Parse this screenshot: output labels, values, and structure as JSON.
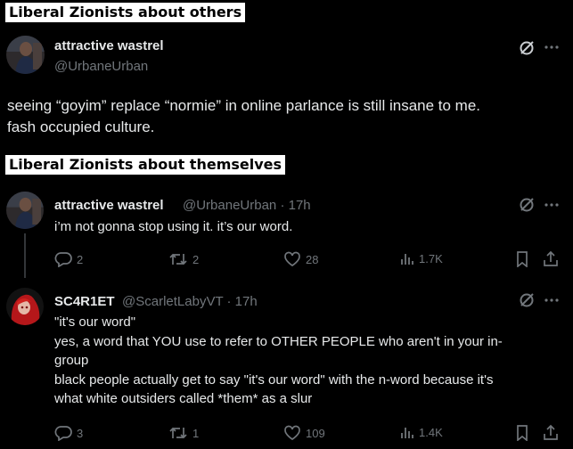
{
  "captions": {
    "others": "Liberal Zionists about others",
    "themselves": "Liberal Zionists about themselves"
  },
  "tweet1": {
    "name": "attractive wastrel",
    "handle": "@UrbaneUrban",
    "text_line1": "seeing “goyim” replace “normie” in online parlance is still insane to me.",
    "text_line2": "fash occupied culture."
  },
  "tweet2": {
    "name": "attractive wastrel",
    "handle_time": "@UrbaneUrban · 17h",
    "text": "i’m not gonna stop using it. it’s our word.",
    "replies": "2",
    "retweets": "2",
    "likes": "28",
    "views": "1.7K"
  },
  "tweet3": {
    "name": "SC4R1ET",
    "handle_time": "@ScarletLabyVT · 17h",
    "lines": [
      "\"it's our word\"",
      "yes, a word that YOU use to refer to OTHER PEOPLE who aren't in your in-",
      "group",
      "black people actually get to say \"it's our word\" with the n-word because it's",
      "what white outsiders called *them* as a slur"
    ],
    "replies": "3",
    "retweets": "1",
    "likes": "109",
    "views": "1.4K"
  },
  "colors": {
    "background": "#000000",
    "text": "#e7e9ea",
    "muted": "#71767b"
  }
}
